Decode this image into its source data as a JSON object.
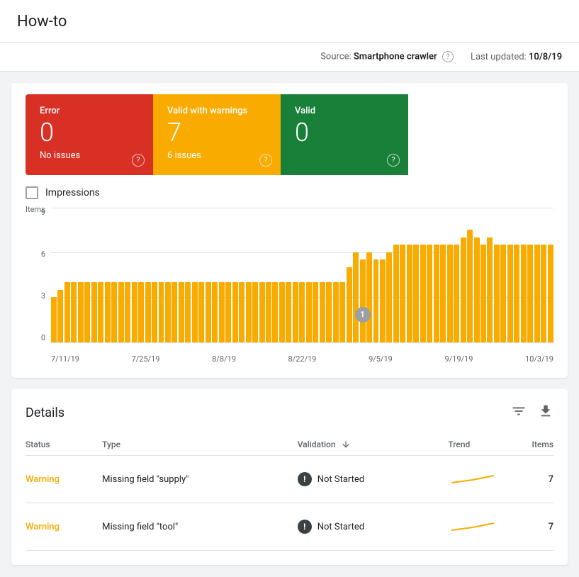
{
  "page": {
    "title": "How-to"
  },
  "source_bar": {
    "source_label": "Source:",
    "source_value": "Smartphone crawler",
    "last_updated_label": "Last updated:",
    "last_updated_value": "10/8/19"
  },
  "status_cards": [
    {
      "label": "Error",
      "number": "0",
      "issues": "No issues",
      "type": "error"
    },
    {
      "label": "Valid with warnings",
      "number": "7",
      "issues": "6 issues",
      "type": "warning"
    },
    {
      "label": "Valid",
      "number": "0",
      "issues": "",
      "type": "valid"
    }
  ],
  "chart": {
    "items_label": "Items",
    "checkbox_label": "Impressions",
    "y_labels": [
      "9",
      "6",
      "3",
      "0"
    ],
    "x_labels": [
      "7/11/19",
      "7/25/19",
      "8/8/19",
      "8/22/19",
      "9/5/19",
      "9/19/19",
      "10/3/19"
    ],
    "annotation_label": "1",
    "bars": [
      3,
      3.5,
      4,
      4,
      4,
      4,
      4,
      4,
      4,
      4,
      4,
      4,
      4,
      4,
      4,
      4,
      4,
      4,
      4,
      4,
      4,
      4,
      4,
      4,
      4,
      4,
      4,
      4,
      4,
      4,
      4,
      4,
      4,
      4,
      4,
      4,
      4,
      4,
      4,
      4,
      4,
      4,
      4,
      4,
      5,
      6,
      5.5,
      6,
      5.5,
      5.5,
      6,
      6.5,
      6.5,
      6.5,
      6.5,
      6.5,
      6.5,
      6.5,
      6.5,
      6.5,
      6.5,
      7,
      7.5,
      7,
      6.5,
      7,
      6.5,
      6.5,
      6.5,
      6.5,
      6.5,
      6.5,
      6.5,
      6.5,
      6.5
    ]
  },
  "details": {
    "title": "Details",
    "table": {
      "headers": {
        "status": "Status",
        "type": "Type",
        "validation": "Validation",
        "trend": "Trend",
        "items": "Items"
      },
      "rows": [
        {
          "status": "Warning",
          "type": "Missing field \"supply\"",
          "validation_icon": "!",
          "validation_text": "Not Started",
          "items": "7"
        },
        {
          "status": "Warning",
          "type": "Missing field \"tool\"",
          "validation_icon": "!",
          "validation_text": "Not Started",
          "items": "7"
        }
      ]
    },
    "filter_icon": "≡",
    "download_icon": "↓"
  }
}
